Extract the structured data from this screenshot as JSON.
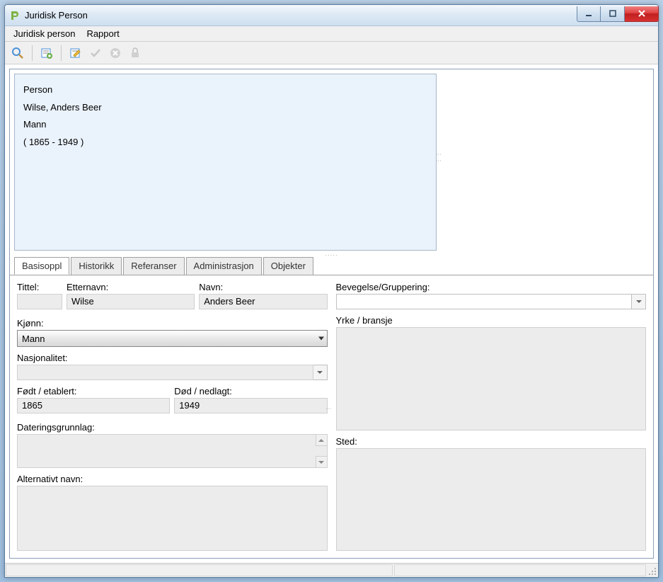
{
  "window": {
    "title": "Juridisk Person"
  },
  "menu": {
    "items": [
      "Juridisk person",
      "Rapport"
    ]
  },
  "toolbar": {
    "icons": [
      "search-icon",
      "new-form-icon",
      "edit-form-icon",
      "check-icon",
      "cancel-icon",
      "lock-icon"
    ]
  },
  "summary": {
    "type": "Person",
    "name": "Wilse, Anders Beer",
    "gender": "Mann",
    "lifespan": "( 1865 - 1949 )"
  },
  "tabs": [
    "Basisoppl",
    "Historikk",
    "Referanser",
    "Administrasjon",
    "Objekter"
  ],
  "active_tab": 0,
  "form": {
    "tittel": {
      "label": "Tittel:",
      "value": ""
    },
    "etternavn": {
      "label": "Etternavn:",
      "value": "Wilse"
    },
    "navn": {
      "label": "Navn:",
      "value": "Anders Beer"
    },
    "kjonn": {
      "label": "Kjønn:",
      "value": "Mann"
    },
    "nasjonalitet": {
      "label": "Nasjonalitet:",
      "value": ""
    },
    "fodt": {
      "label": "Født / etablert:",
      "value": "1865"
    },
    "dod": {
      "label": "Død / nedlagt:",
      "value": "1949"
    },
    "dateringsgrunnlag": {
      "label": "Dateringsgrunnlag:",
      "value": ""
    },
    "alternativt_navn": {
      "label": "Alternativt navn:",
      "value": ""
    },
    "bevegelse": {
      "label": "Bevegelse/Gruppering:",
      "value": ""
    },
    "yrke": {
      "label": "Yrke / bransje",
      "value": ""
    },
    "sted": {
      "label": "Sted:",
      "value": ""
    }
  }
}
